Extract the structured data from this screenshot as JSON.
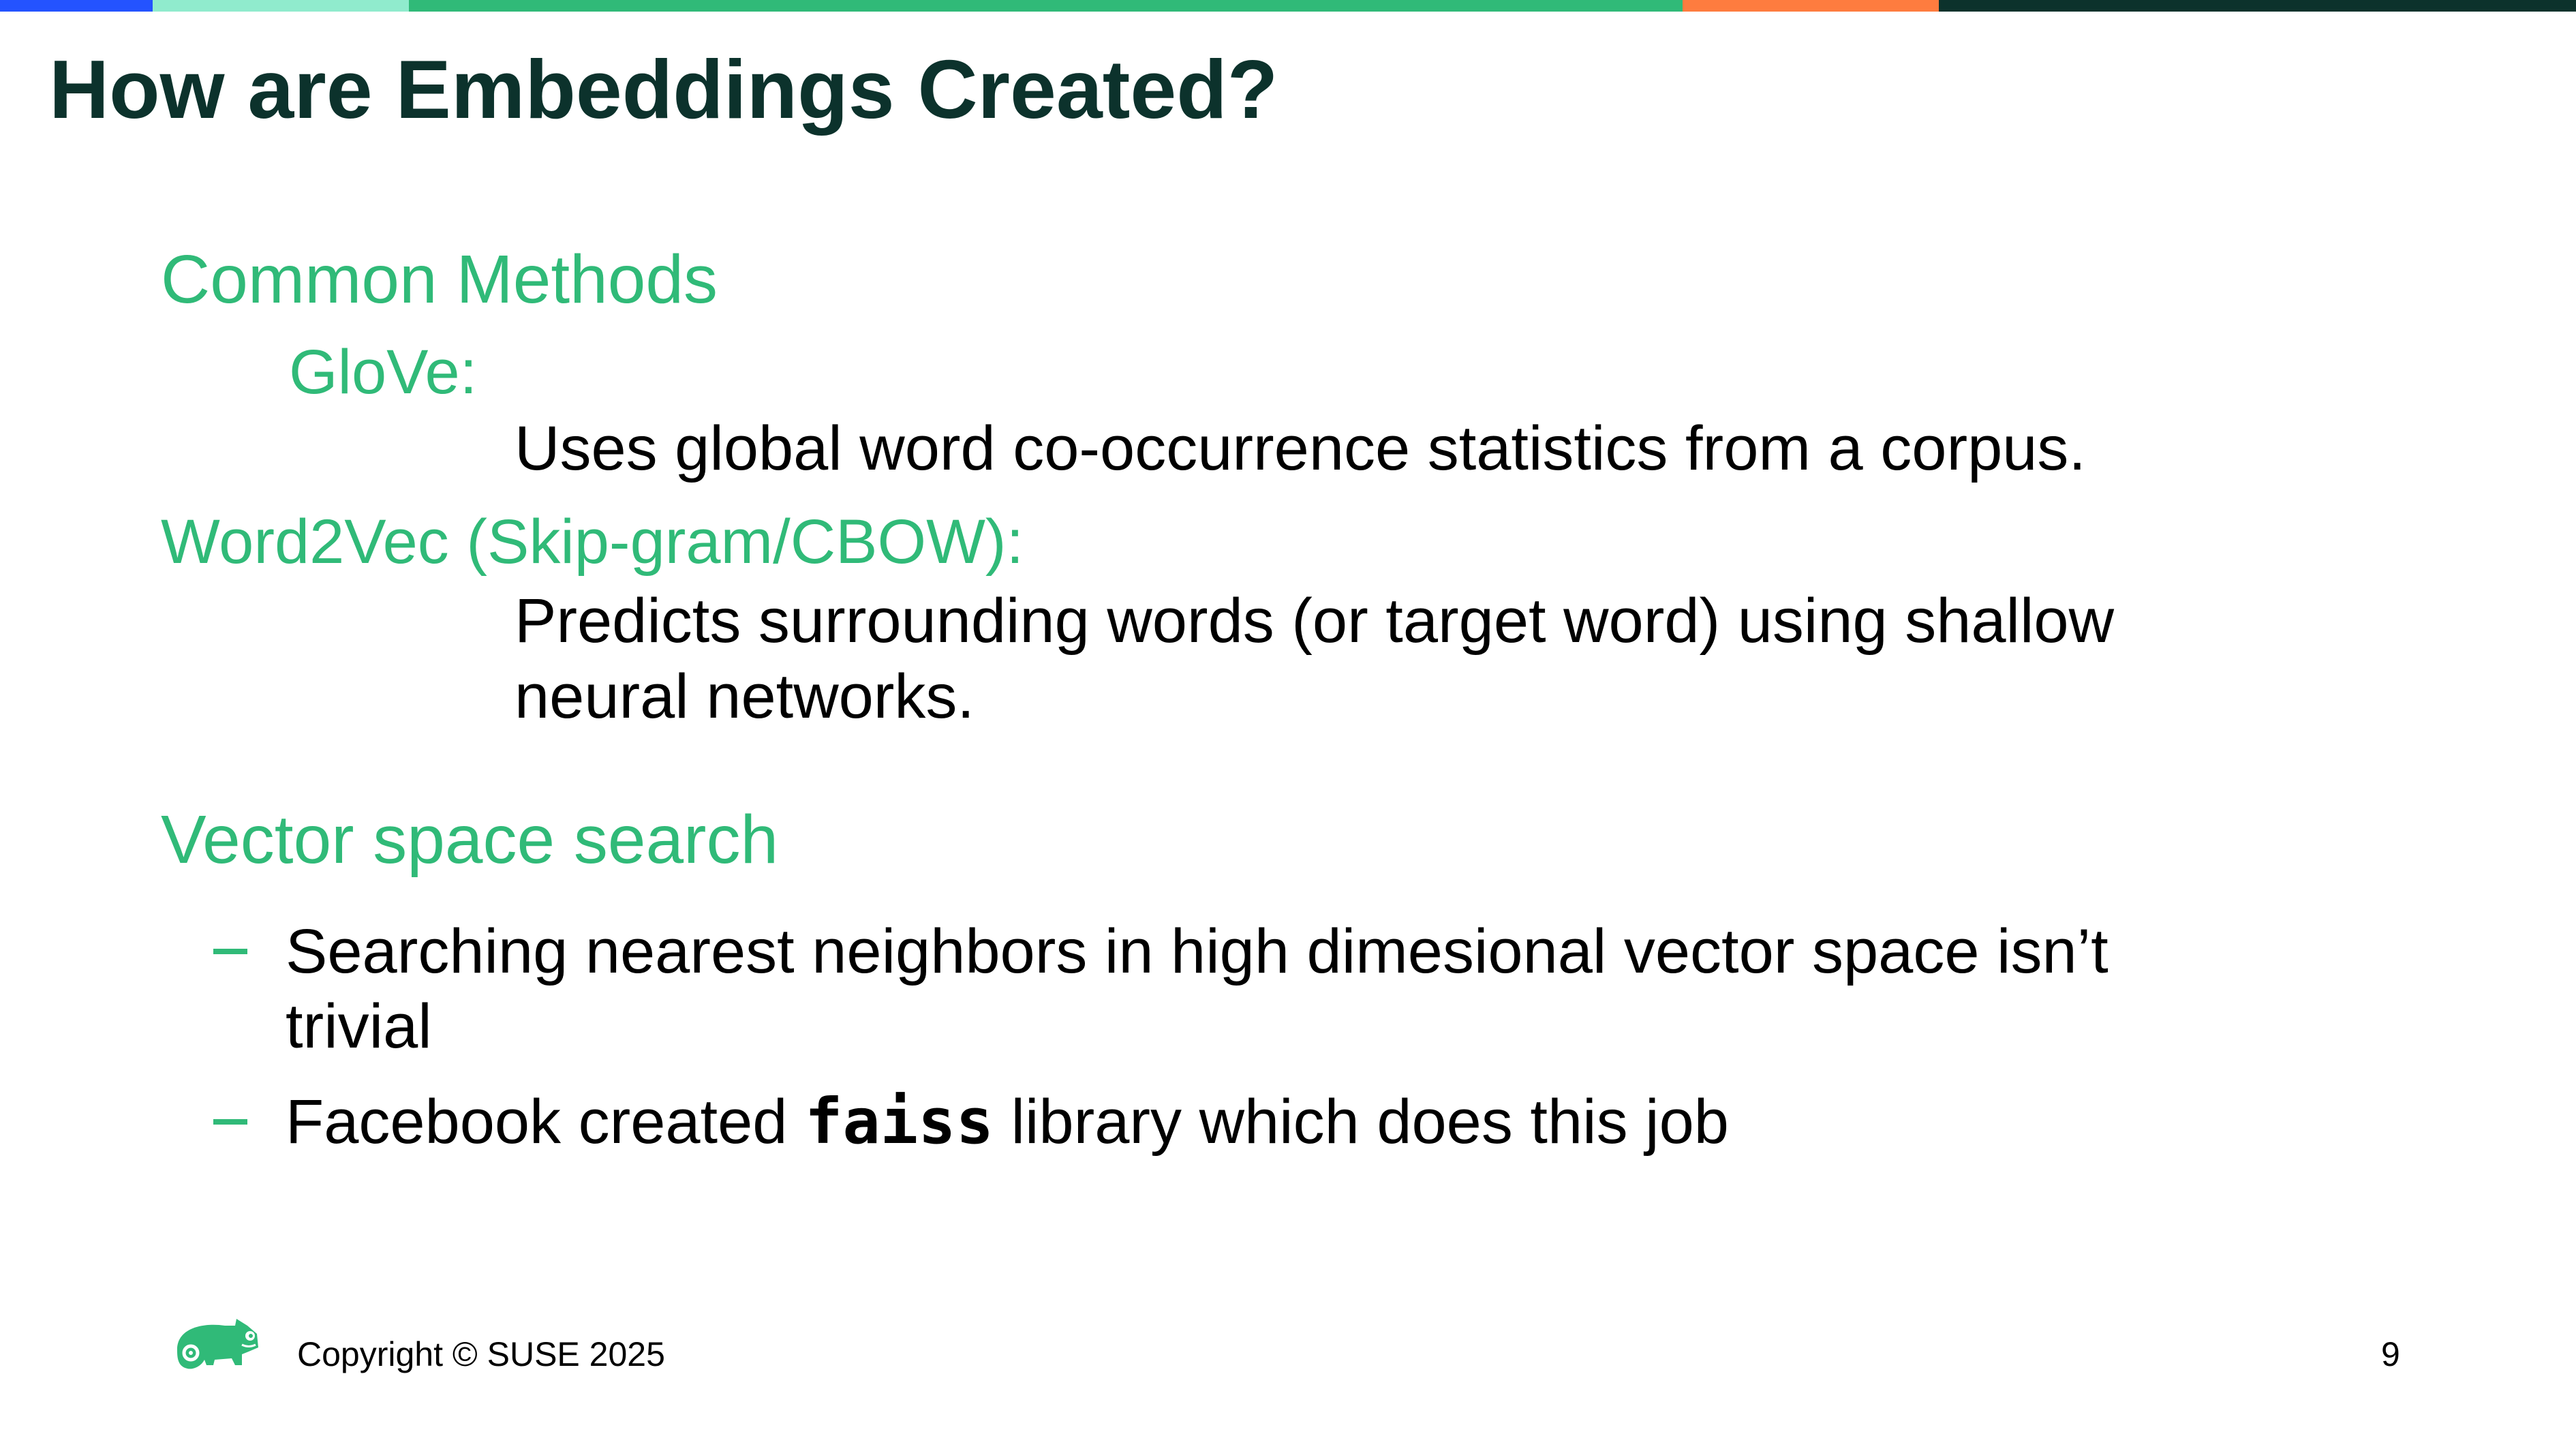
{
  "colors": {
    "bar": [
      "#2453ff",
      "#90ebcd",
      "#30ba78",
      "#fe7c3f",
      "#0c322c"
    ],
    "accent": "#30ba78",
    "title": "#0c322c"
  },
  "title": "How are Embeddings Created?",
  "sections": {
    "common_methods": "Common Methods",
    "glove_label": "GloVe:",
    "glove_desc": "Uses global word co-occurrence statistics from a corpus.",
    "word2vec_label": "Word2Vec (Skip-gram/CBOW):",
    "word2vec_desc_1": "Predicts surrounding words (or target word) using shallow",
    "word2vec_desc_2": "neural networks.",
    "vector_search": "Vector space search",
    "bullet1_line1": "Searching nearest neighbors in high dimesional vector space isn’t",
    "bullet1_line2": "trivial",
    "bullet2_pre": "Facebook created ",
    "bullet2_code": "faiss",
    "bullet2_post": " library which does this job"
  },
  "footer": {
    "copyright": "Copyright © SUSE 2025",
    "page": "9",
    "logo": "suse-chameleon-logo"
  }
}
